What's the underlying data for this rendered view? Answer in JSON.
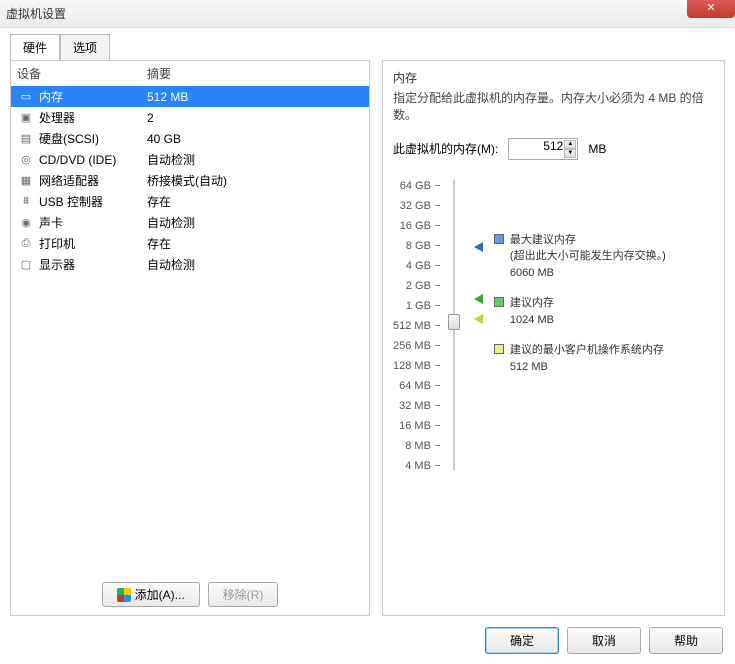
{
  "window": {
    "title": "虚拟机设置",
    "close": "✕"
  },
  "tabs": {
    "hardware": "硬件",
    "options": "选项"
  },
  "hw_header": {
    "device": "设备",
    "summary": "摘要"
  },
  "hw": [
    {
      "icon": "▭",
      "name": "内存",
      "summary": "512 MB",
      "selected": true
    },
    {
      "icon": "▣",
      "name": "处理器",
      "summary": "2"
    },
    {
      "icon": "▤",
      "name": "硬盘(SCSI)",
      "summary": "40 GB"
    },
    {
      "icon": "◎",
      "name": "CD/DVD (IDE)",
      "summary": "自动检测"
    },
    {
      "icon": "▦",
      "name": "网络适配器",
      "summary": "桥接模式(自动)"
    },
    {
      "icon": "⩩",
      "name": "USB 控制器",
      "summary": "存在"
    },
    {
      "icon": "◉",
      "name": "声卡",
      "summary": "自动检测"
    },
    {
      "icon": "⎙",
      "name": "打印机",
      "summary": "存在"
    },
    {
      "icon": "▢",
      "name": "显示器",
      "summary": "自动检测"
    }
  ],
  "buttons": {
    "add": "添加(A)...",
    "remove": "移除(R)",
    "ok": "确定",
    "cancel": "取消",
    "help": "帮助"
  },
  "mem": {
    "title": "内存",
    "desc": "指定分配给此虚拟机的内存量。内存大小必须为 4 MB 的倍数。",
    "label": "此虚拟机的内存(M):",
    "value": "512",
    "unit": "MB",
    "ticks": [
      "64 GB",
      "32 GB",
      "16 GB",
      "8 GB",
      "4 GB",
      "2 GB",
      "1 GB",
      "512 MB",
      "256 MB",
      "128 MB",
      "64 MB",
      "32 MB",
      "16 MB",
      "8 MB",
      "4 MB"
    ],
    "legend": {
      "max": {
        "title": "最大建议内存",
        "note": "(超出此大小可能发生内存交换。)",
        "value": "6060 MB"
      },
      "rec": {
        "title": "建议内存",
        "value": "1024 MB"
      },
      "min": {
        "title": "建议的最小客户机操作系统内存",
        "value": "512 MB"
      }
    }
  },
  "chart_data": {
    "type": "scale",
    "ticks": [
      "64 GB",
      "32 GB",
      "16 GB",
      "8 GB",
      "4 GB",
      "2 GB",
      "1 GB",
      "512 MB",
      "256 MB",
      "128 MB",
      "64 MB",
      "32 MB",
      "16 MB",
      "8 MB",
      "4 MB"
    ],
    "current_value_mb": 512,
    "markers": [
      {
        "name": "最大建议内存",
        "value_mb": 6060,
        "color": "blue"
      },
      {
        "name": "建议内存",
        "value_mb": 1024,
        "color": "green"
      },
      {
        "name": "建议的最小客户机操作系统内存",
        "value_mb": 512,
        "color": "yellow"
      }
    ]
  }
}
